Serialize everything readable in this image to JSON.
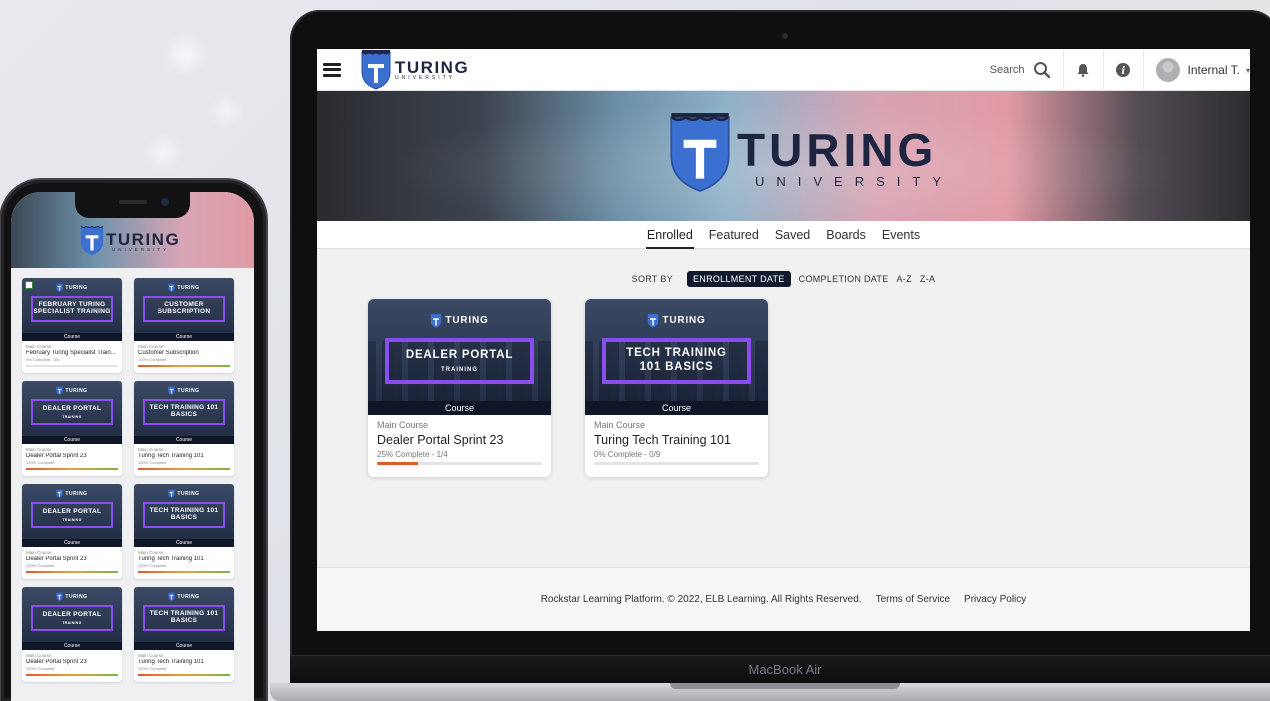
{
  "laptop_label": "MacBook Air",
  "brand": {
    "word": "TURING",
    "sub": "UNIVERSITY",
    "shield_color": "#3b6fd0"
  },
  "header": {
    "search_label": "Search",
    "user_name": "Internal T."
  },
  "tabs": [
    {
      "label": "Enrolled",
      "active": true
    },
    {
      "label": "Featured"
    },
    {
      "label": "Saved"
    },
    {
      "label": "Boards"
    },
    {
      "label": "Events"
    }
  ],
  "sort": {
    "label": "SORT BY",
    "options": [
      "ENROLLMENT DATE",
      "COMPLETION DATE",
      "A-Z",
      "Z-A"
    ],
    "selected": "ENROLLMENT DATE"
  },
  "courses": [
    {
      "image_title": "DEALER PORTAL",
      "image_sub": "TRAINING",
      "type": "Course",
      "category": "Main Course",
      "title": "Dealer Portal Sprint 23",
      "progress_text": "25% Complete - 1/4",
      "progress": 0.25
    },
    {
      "image_title": "TECH TRAINING 101 BASICS",
      "image_sub": "",
      "type": "Course",
      "category": "Main Course",
      "title": "Turing Tech Training 101",
      "progress_text": "0% Complete - 0/9",
      "progress": 0
    }
  ],
  "footer": {
    "copyright": "Rockstar Learning Platform. © 2022, ELB Learning. All Rights Reserved.",
    "terms": "Terms of Service",
    "privacy": "Privacy Policy"
  },
  "phone": {
    "cards": [
      {
        "image_title": "FEBRUARY TURING SPECIALIST TRAINING",
        "image_sub": "",
        "type": "Course",
        "category": "Main Course",
        "title": "February Turing Specialist Train...",
        "progress_text": "0% Complete - 0/5",
        "progress": 0,
        "bar_color": "#e05a2b",
        "checkbox": true
      },
      {
        "image_title": "CUSTOMER SUBSCRIPTION",
        "image_sub": "",
        "type": "Course",
        "category": "Main Course",
        "title": "Customer Subscription",
        "progress_text": "100% Complete",
        "progress": 1,
        "bar_color": "linear-gradient(90deg,#e05a2b,#e6a33a,#7cb342)"
      },
      {
        "image_title": "DEALER PORTAL",
        "image_sub": "TRAINING",
        "type": "Course",
        "category": "Main Course",
        "title": "Dealer Portal Sprint 23",
        "progress_text": "100% Complete",
        "progress": 1,
        "bar_color": "linear-gradient(90deg,#e05a2b,#e6a33a,#7cb342)"
      },
      {
        "image_title": "TECH TRAINING 101 BASICS",
        "image_sub": "",
        "type": "Course",
        "category": "Main Course",
        "title": "Turing Tech Training 101",
        "progress_text": "100% Complete",
        "progress": 1,
        "bar_color": "linear-gradient(90deg,#e05a2b,#e6a33a,#7cb342)"
      },
      {
        "image_title": "DEALER PORTAL",
        "image_sub": "TRAINING",
        "type": "Course",
        "category": "Main Course",
        "title": "Dealer Portal Sprint 23",
        "progress_text": "100% Complete",
        "progress": 1,
        "bar_color": "linear-gradient(90deg,#e05a2b,#e6a33a,#7cb342)"
      },
      {
        "image_title": "TECH TRAINING 101 BASICS",
        "image_sub": "",
        "type": "Course",
        "category": "Main Course",
        "title": "Turing Tech Training 101",
        "progress_text": "100% Complete",
        "progress": 1,
        "bar_color": "linear-gradient(90deg,#e05a2b,#e6a33a,#7cb342)"
      },
      {
        "image_title": "DEALER PORTAL",
        "image_sub": "TRAINING",
        "type": "Course",
        "category": "Main Course",
        "title": "Dealer Portal Sprint 23",
        "progress_text": "100% Complete",
        "progress": 1,
        "bar_color": "linear-gradient(90deg,#e05a2b,#e6a33a,#7cb342)"
      },
      {
        "image_title": "TECH TRAINING 101 BASICS",
        "image_sub": "",
        "type": "Course",
        "category": "Main Course",
        "title": "Turing Tech Training 101",
        "progress_text": "100% Complete",
        "progress": 1,
        "bar_color": "linear-gradient(90deg,#e05a2b,#e6a33a,#7cb342)"
      }
    ]
  },
  "colors": {
    "accent_purple": "#8a4df0",
    "navy": "#101a2e",
    "progress_orange": "#e05a2b"
  }
}
